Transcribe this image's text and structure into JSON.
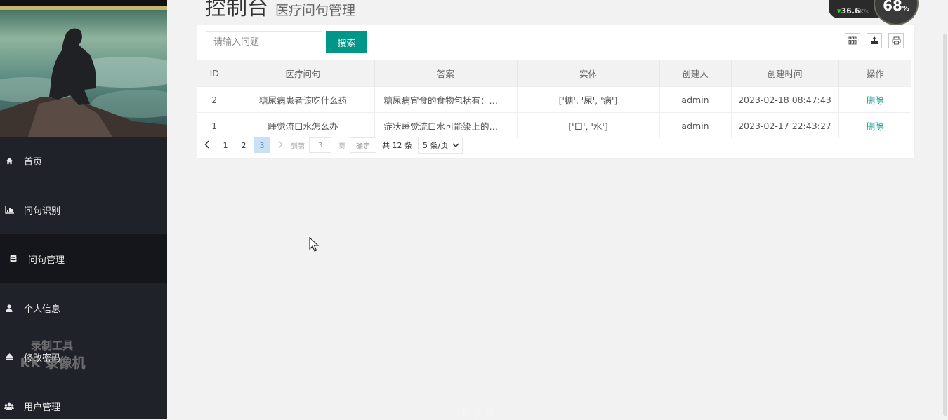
{
  "header": {
    "title": "控制台",
    "subtitle": "医疗问句管理"
  },
  "sidebar": {
    "items": [
      {
        "label": "首页",
        "icon": "home-icon"
      },
      {
        "label": "问句识别",
        "icon": "bar-chart-icon"
      },
      {
        "label": "问句管理",
        "icon": "database-icon",
        "active": true
      },
      {
        "label": "个人信息",
        "icon": "user-icon"
      },
      {
        "label": "修改密码",
        "icon": "eject-icon"
      },
      {
        "label": "用户管理",
        "icon": "users-icon"
      }
    ]
  },
  "watermark": {
    "line1": "录制工具",
    "line2": "KK 录像机"
  },
  "search": {
    "placeholder": "请输入问题",
    "value": "",
    "button_label": "搜索"
  },
  "toolbar": {
    "icons": [
      "columns-icon",
      "export-icon",
      "print-icon"
    ]
  },
  "table": {
    "headers": [
      "ID",
      "医疗问句",
      "答案",
      "实体",
      "创建人",
      "创建时间",
      "操作"
    ],
    "rows": [
      {
        "id": "2",
        "question": "糖尿病患者该吃什么药",
        "answer": "糖尿病宜食的食物包括有：茄...",
        "entities": "['糖', '尿', '病']",
        "creator": "admin",
        "created_at": "2023-02-18 08:47:43",
        "action": "删除"
      },
      {
        "id": "1",
        "question": "睡觉流口水怎么办",
        "answer": "症状睡觉流口水可能染上的疾...",
        "entities": "['口', '水']",
        "creator": "admin",
        "created_at": "2023-02-17 22:43:27",
        "action": "删除"
      }
    ]
  },
  "pagination": {
    "pages": [
      "1",
      "2",
      "3"
    ],
    "current": "3",
    "goto_label": "到第",
    "goto_value": "3",
    "page_unit": "页",
    "confirm_label": "确定",
    "total_label": "共 12 条",
    "page_size_label": "5 条/页"
  },
  "overlay": {
    "speed_value": "36.6",
    "speed_unit": "K/s",
    "gauge_value": "68",
    "gauge_unit": "%",
    "page_indicator": "8 / 9"
  },
  "colors": {
    "accent": "#009688",
    "sidebar_bg": "#20222a",
    "sidebar_active_bg": "#15161b",
    "content_bg": "#f2f2f2"
  }
}
